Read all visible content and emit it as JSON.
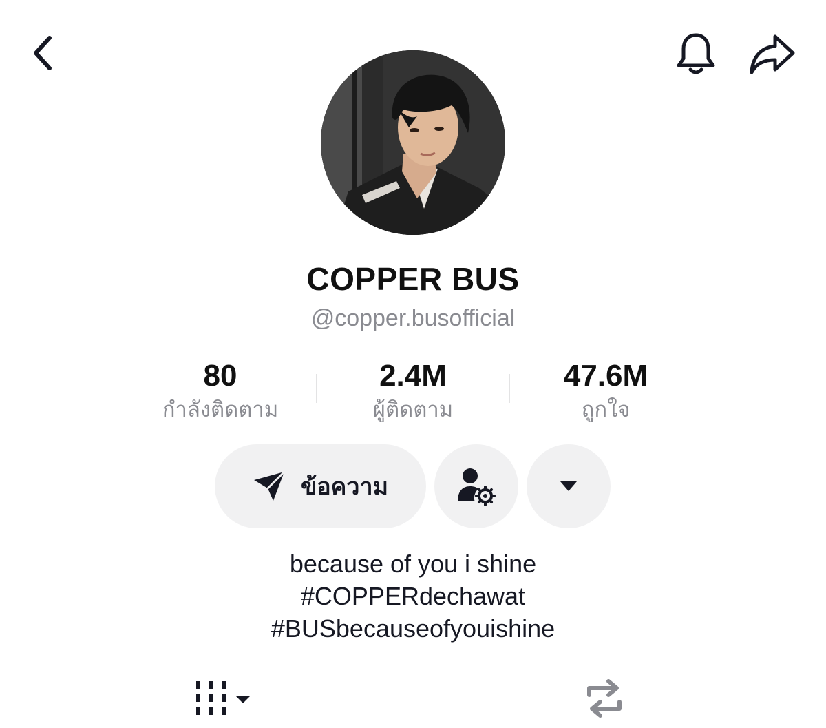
{
  "header": {
    "back_icon": "chevron-left-icon",
    "bell_icon": "bell-icon",
    "share_icon": "share-arrow-icon"
  },
  "profile": {
    "display_name": "COPPER BUS",
    "username": "@copper.busofficial",
    "bio": {
      "line1": "because of you i shine",
      "line2": "#COPPERdechawat",
      "line3": "#BUSbecauseofyouishine"
    }
  },
  "stats": {
    "following": {
      "value": "80",
      "label": "กำลังติดตาม"
    },
    "followers": {
      "value": "2.4M",
      "label": "ผู้ติดตาม"
    },
    "likes": {
      "value": "47.6M",
      "label": "ถูกใจ"
    }
  },
  "actions": {
    "message_label": "ข้อความ",
    "message_icon": "send-icon",
    "friend_icon": "user-settings-icon",
    "more_icon": "caret-down-icon"
  },
  "tabs": {
    "videos_icon": "grid-icon",
    "reposts_icon": "repost-icon"
  },
  "colors": {
    "primary_text": "#161823",
    "secondary_text": "#8a8b91",
    "button_bg": "#f1f1f2"
  }
}
